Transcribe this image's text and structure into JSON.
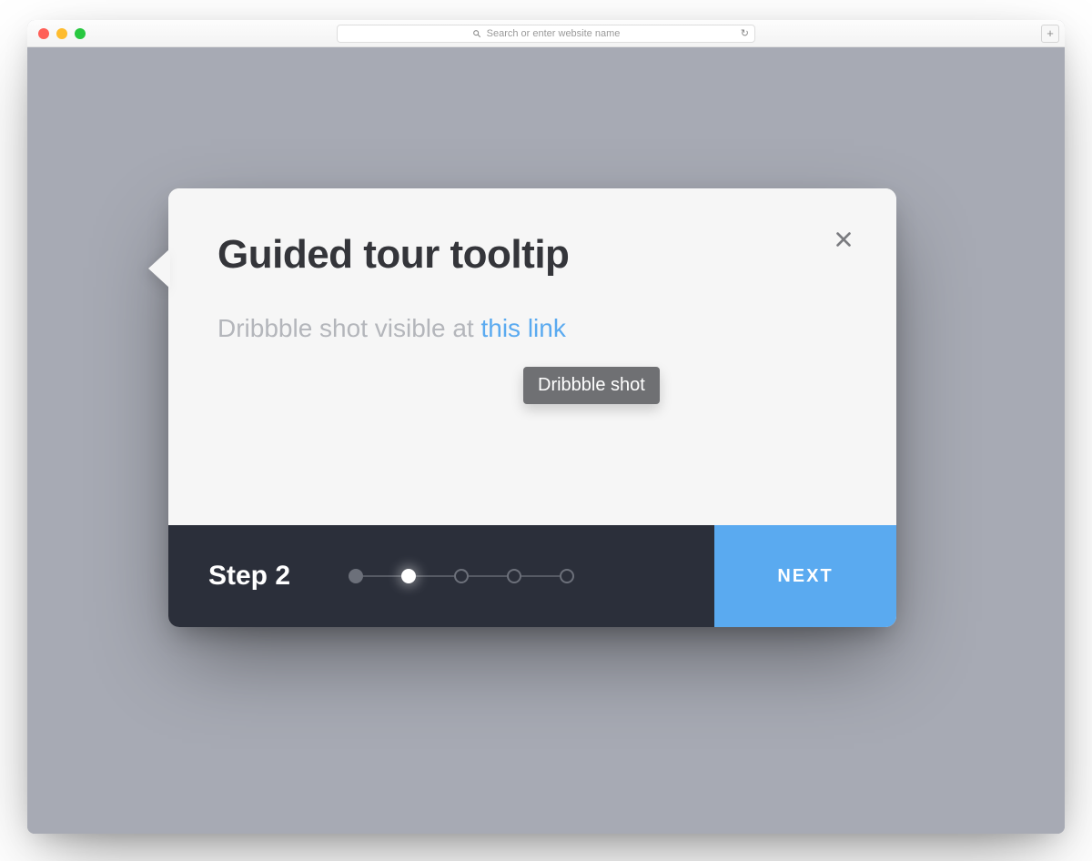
{
  "browser": {
    "address_placeholder": "Search or enter website name"
  },
  "tour": {
    "title": "Guided tour tooltip",
    "subtitle_prefix": "Dribbble shot visible at ",
    "subtitle_link": "this link",
    "link_tooltip": "Dribbble shot",
    "step_label": "Step 2",
    "next_label": "NEXT",
    "progress": {
      "total": 5,
      "current_index": 1
    }
  }
}
